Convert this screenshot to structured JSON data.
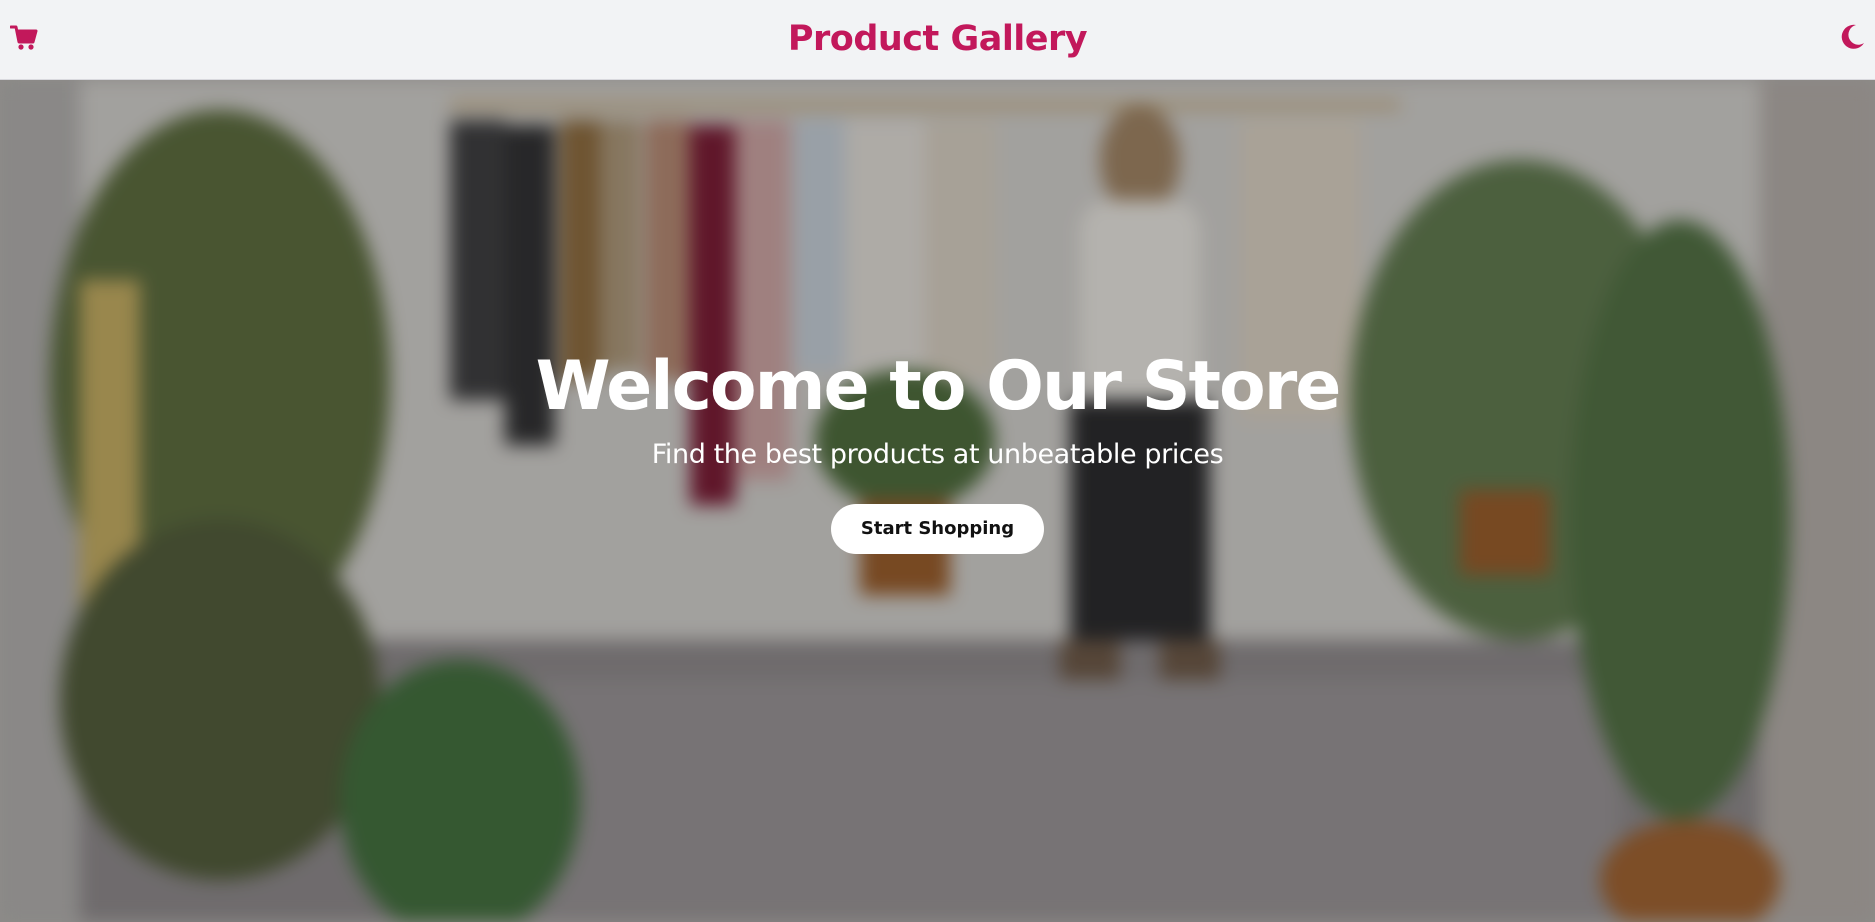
{
  "header": {
    "title": "Product Gallery",
    "cart_icon": "shopping-cart-icon",
    "theme_icon": "moon-icon"
  },
  "hero": {
    "heading": "Welcome to Our Store",
    "subheading": "Find the best products at unbeatable prices",
    "cta_label": "Start Shopping",
    "background": "blurred clothing store photo"
  },
  "colors": {
    "brand": "#c2185b",
    "header_bg": "#f2f3f5",
    "button_bg": "#ffffff",
    "button_text": "#111111",
    "hero_text": "#ffffff"
  }
}
